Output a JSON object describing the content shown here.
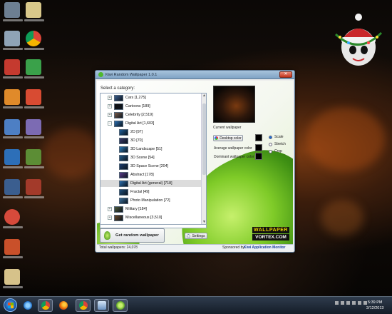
{
  "window": {
    "title": "Kiwi Random Wallpaper 1.0.1",
    "close_label": "✕"
  },
  "tree": {
    "label": "Select a category:",
    "rows": [
      {
        "text": "Cars [1,275]",
        "level": 0,
        "expander": "+",
        "thumb_color": "#3a5f8f"
      },
      {
        "text": "Cartoons [189]",
        "level": 0,
        "expander": "+",
        "thumb_color": "#111111"
      },
      {
        "text": "Celebrity [2,519]",
        "level": 0,
        "expander": "+",
        "thumb_color": "#7a5c4a"
      },
      {
        "text": "Digital Art [1,603]",
        "level": 0,
        "expander": "−",
        "thumb_color": "#2a6fb0"
      },
      {
        "text": "2D [97]",
        "level": 1,
        "expander": "",
        "thumb_color": "#1d5e9a"
      },
      {
        "text": "3D [70]",
        "level": 1,
        "expander": "",
        "thumb_color": "#3a3a6a"
      },
      {
        "text": "3D Landscape [51]",
        "level": 1,
        "expander": "",
        "thumb_color": "#2c7bb8"
      },
      {
        "text": "3D Scene [54]",
        "level": 1,
        "expander": "",
        "thumb_color": "#245a8a"
      },
      {
        "text": "3D Space Scene [204]",
        "level": 1,
        "expander": "",
        "thumb_color": "#1b3d6e"
      },
      {
        "text": "Abstract [178]",
        "level": 1,
        "expander": "",
        "thumb_color": "#5a3a8a"
      },
      {
        "text": "Digital Art (general) [718]",
        "level": 1,
        "expander": "",
        "thumb_color": "#2a6fb0"
      },
      {
        "text": "Fractal [49]",
        "level": 1,
        "expander": "",
        "thumb_color": "#1e4f7c"
      },
      {
        "text": "Photo Manipulation [72]",
        "level": 1,
        "expander": "",
        "thumb_color": "#3b6f9b"
      },
      {
        "text": "Military [184]",
        "level": 0,
        "expander": "+",
        "thumb_color": "#4f5a3a"
      },
      {
        "text": "Miscellaneous [3,510]",
        "level": 0,
        "expander": "+",
        "thumb_color": "#6a4a2a"
      }
    ],
    "selected_index": 10
  },
  "right": {
    "current_label": "Current wallpaper",
    "desktop_color_button": "Desktop color",
    "average_label": "Average wallpaper color",
    "dominant_label": "Dominant wallpaper color",
    "options": [
      "Scale",
      "Stretch",
      "Crop"
    ],
    "selected_option": "Scale"
  },
  "buttons": {
    "get_random": "Get random wallpaper",
    "settings": "Settings"
  },
  "logo": {
    "line1": "WALLPAPER",
    "line2": "VORTEX.COM"
  },
  "status": {
    "total": "Total wallpapers: 24,078",
    "sponsored": "Sponsored by:",
    "sponsor_link": "Kiwi Application Monitor"
  },
  "taskbar": {
    "time": "5:39 PM",
    "date": "2/12/2013"
  },
  "colors": {
    "accent_green": "#7fcb28",
    "link_blue": "#1a3f9e",
    "swatch": "#000000"
  }
}
